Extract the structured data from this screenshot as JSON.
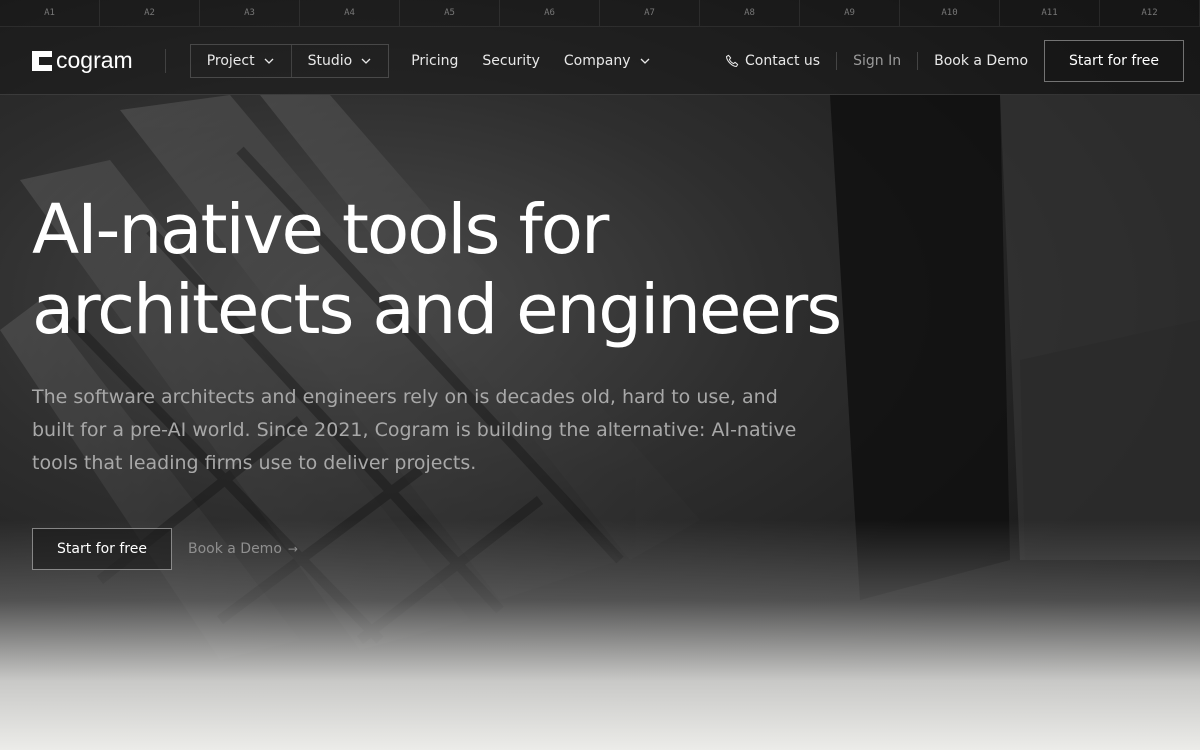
{
  "ruler": [
    "A1",
    "A2",
    "A3",
    "A4",
    "A5",
    "A6",
    "A7",
    "A8",
    "A9",
    "A10",
    "A11",
    "A12"
  ],
  "brand": {
    "name": "cogram"
  },
  "nav": {
    "menus": [
      {
        "label": "Project"
      },
      {
        "label": "Studio"
      }
    ],
    "links": [
      {
        "label": "Pricing"
      },
      {
        "label": "Security"
      }
    ],
    "company": {
      "label": "Company"
    },
    "contact": "Contact us",
    "signin": "Sign In",
    "demo": "Book a Demo",
    "start": "Start for free"
  },
  "hero": {
    "title_line1": "AI-native tools for",
    "title_line2": "architects and engineers",
    "subtitle": "The software architects and engineers rely on is decades old, hard to use, and built for a pre-AI world. Since 2021, Cogram is building the alternative: AI-native tools that leading firms use to deliver projects.",
    "cta_primary": "Start for free",
    "cta_secondary": "Book a Demo",
    "cta_arrow": "→"
  },
  "colors": {
    "background": "#1a1a1a",
    "text": "#ffffff",
    "muted": "#a8a8a8",
    "fog": "#ecece9"
  }
}
